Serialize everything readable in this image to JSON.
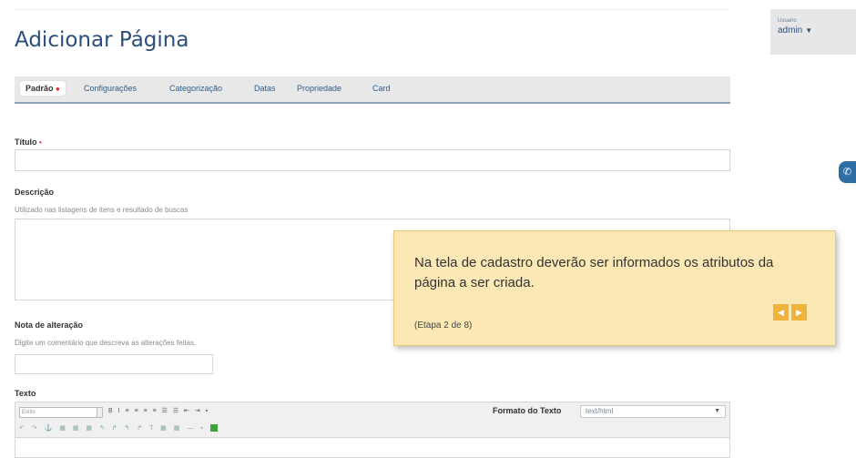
{
  "page": {
    "title": "Adicionar Página"
  },
  "user": {
    "label": "Usuario",
    "name": "admin"
  },
  "tabs": [
    {
      "label": "Padrão",
      "active": true,
      "required": true
    },
    {
      "label": "Configurações"
    },
    {
      "label": "Categorização"
    },
    {
      "label": "Datas"
    },
    {
      "label": "Propriedade"
    },
    {
      "label": "Card"
    }
  ],
  "form": {
    "titulo": {
      "label": "Título",
      "required_mark": "•",
      "value": ""
    },
    "descricao": {
      "label": "Descrição",
      "hint": "Utilizado nas listagens de itens e resultado de buscas",
      "value": ""
    },
    "nota": {
      "label": "Nota de alteração",
      "hint": "Digite um comentário que descreva as alterações feitas.",
      "value": ""
    },
    "texto": {
      "label": "Texto",
      "style_placeholder": "Estilo",
      "format_label": "Formato do Texto",
      "format_value": "text/html"
    }
  },
  "tour": {
    "message": "Na tela de cadastro deverão ser informados os atributos da página a ser criada.",
    "step": "(Etapa 2 de 8)",
    "prev_icon": "chevron-left-icon",
    "next_icon": "chevron-right-icon"
  },
  "colors": {
    "title": "#2b4f7a",
    "tab_link": "#2f5d8c",
    "required": "#e0242c",
    "tour_bg": "#fce8b4",
    "tour_button": "#f0b43c"
  }
}
